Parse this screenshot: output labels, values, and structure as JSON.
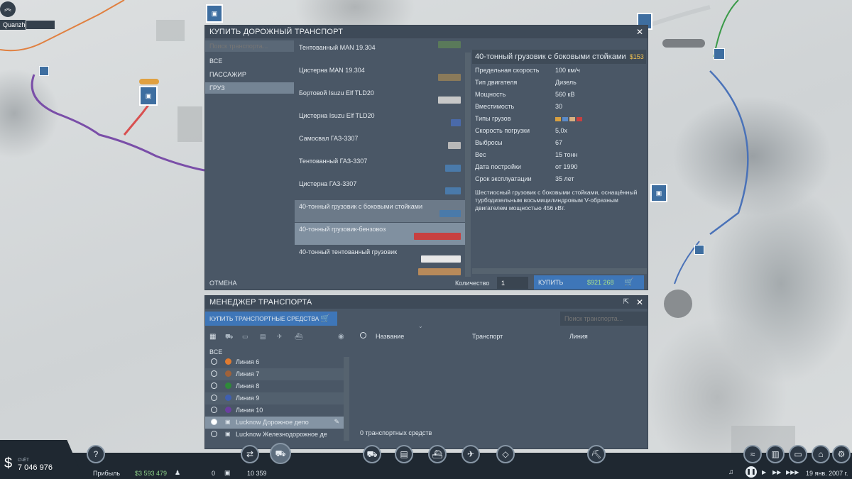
{
  "map": {
    "city_label": "Quanzhou"
  },
  "buy_window": {
    "title": "КУПИТЬ ДОРОЖНЫЙ ТРАНСПОРТ",
    "search_placeholder": "Поиск транспорта...",
    "categories": [
      "ВСЕ",
      "ПАССАЖИР",
      "ГРУЗ"
    ],
    "vehicles": [
      "Тентованный MAN 19.304",
      "Цистерна MAN 19.304",
      "Бортовой Isuzu Elf TLD20",
      "Цистерна Isuzu Elf TLD20",
      "Самосвал ГАЗ-3307",
      "Тентованный ГАЗ-3307",
      "Цистерна ГАЗ-3307",
      "40-тонный грузовик с боковыми стойками",
      "40-тонный грузовик-бензовоз",
      "40-тонный тентованный грузовик"
    ],
    "selected_title": "40-тонный грузовик с боковыми стойками",
    "selected_price_short": "$153",
    "stats": [
      {
        "k": "Предельная скорость",
        "v": "100 км/ч"
      },
      {
        "k": "Тип двигателя",
        "v": "Дизель"
      },
      {
        "k": "Мощность",
        "v": "560 кВ"
      },
      {
        "k": "Вместимость",
        "v": "30"
      },
      {
        "k": "Типы грузов",
        "v": ""
      },
      {
        "k": "Скорость погрузки",
        "v": "5,0x"
      },
      {
        "k": "Выбросы",
        "v": "67"
      },
      {
        "k": "Вес",
        "v": "15 тонн"
      },
      {
        "k": "Дата постройки",
        "v": "от 1990"
      },
      {
        "k": "Срок эксплуатации",
        "v": "35 лет"
      }
    ],
    "description": "Шестиосный грузовик с боковыми стойками, оснащённый турбодизельным восьмицилиндровым V-образным двигателем мощностью 456 кВт.",
    "cancel": "ОТМЕНА",
    "quantity_label": "Количество",
    "quantity_value": "1",
    "buy_label": "КУПИТЬ",
    "buy_price": "$921 268"
  },
  "manager": {
    "title": "МЕНЕДЖЕР ТРАНСПОРТА",
    "buy_button": "КУПИТЬ ТРАНСПОРТНЫЕ СРЕДСТВА",
    "search_placeholder": "Поиск транспорта...",
    "all": "ВСЕ",
    "lines": [
      {
        "name": "Линия 6",
        "color": "#e07b30"
      },
      {
        "name": "Линия 7",
        "color": "#a0623a"
      },
      {
        "name": "Линия 8",
        "color": "#2f8a3a"
      },
      {
        "name": "Линия 9",
        "color": "#3f5fb0"
      },
      {
        "name": "Линия 10",
        "color": "#6b3fa0"
      }
    ],
    "depots": [
      "Lucknow Дорожное депо",
      "Lucknow Железнодорожное де"
    ],
    "col_name": "Название",
    "col_vehicle": "Транспорт",
    "col_line": "Линия",
    "count": "0 транспортных средств"
  },
  "taskbar": {
    "account_label": "СЧЁТ",
    "balance": "7 046 976",
    "profit_label": "Прибыль",
    "profit": "$3 593 479",
    "passengers": "0",
    "cargo": "10 359",
    "date": "19 янв. 2007 г."
  }
}
